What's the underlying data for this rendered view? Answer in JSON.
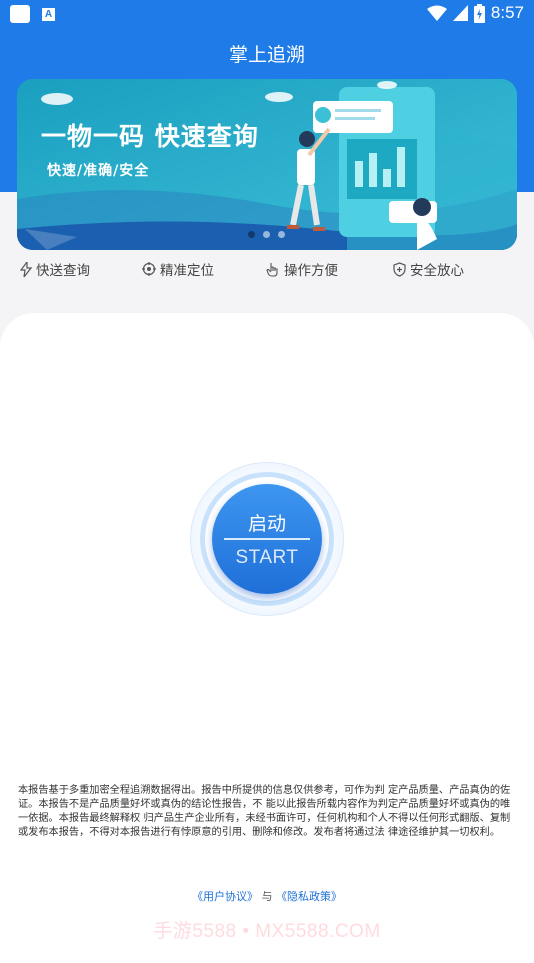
{
  "status_bar": {
    "time": "8:57",
    "app_icon_letter": "A",
    "icons": [
      "notification-square-icon",
      "app-a-icon",
      "wifi-icon",
      "signal-icon",
      "battery-icon"
    ]
  },
  "app": {
    "title": "掌上追溯"
  },
  "banner": {
    "title": "一物一码  快速查询",
    "subtitle": "快速/准确/安全",
    "page_count": 3,
    "active_index": 0
  },
  "features": [
    {
      "label": "快送查询",
      "icon": "lightning-icon"
    },
    {
      "label": "精准定位",
      "icon": "target-icon"
    },
    {
      "label": "操作方便",
      "icon": "hand-pointer-icon"
    },
    {
      "label": "安全放心",
      "icon": "shield-plus-icon"
    }
  ],
  "start_button": {
    "label_cn": "启动",
    "label_en": "START"
  },
  "disclaimer": "本报告基于多重加密全程追溯数据得出。报告中所提供的信息仅供参考，可作为判 定产品质量、产品真伪的佐证。本报告不是产品质量好坏或真伪的结论性报告，不 能以此报告所载内容作为判定产品质量好坏或真伪的唯一依据。本报告最终解释权 归产品生产企业所有，未经书面许可，任何机构和个人不得以任何形式翻版、复制 或发布本报告，不得对本报告进行有悖原意的引用、删除和修改。发布者将通过法 律途径维护其一切权利。",
  "agreement": {
    "user_agreement": "《用户协议》",
    "conjunction": "与",
    "privacy_policy": "《隐私政策》"
  },
  "watermark": "手游5588 • MX5588.COM",
  "colors": {
    "primary": "#1e7be8",
    "banner_bg": "#20a9c6",
    "link": "#1e6fd8"
  }
}
